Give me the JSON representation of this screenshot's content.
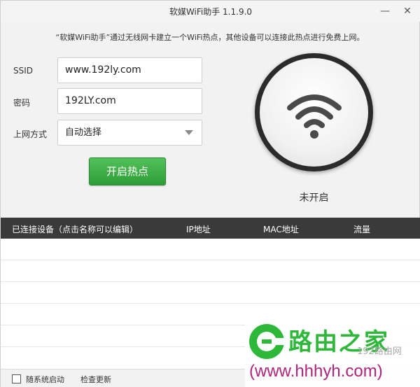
{
  "window": {
    "title": "软媒WiFi助手 1.1.9.0",
    "min_glyph": "—",
    "close_glyph": "✕"
  },
  "description": "“软媒WiFi助手”通过无线网卡建立一个WiFi热点，其他设备可以连接此热点进行免费上网。",
  "form": {
    "ssid_label": "SSID",
    "ssid_value": "www.192ly.com",
    "password_label": "密码",
    "password_value": "192LY.com",
    "mode_label": "上网方式",
    "mode_value": "自动选择"
  },
  "start_button": "开启热点",
  "status": {
    "text": "未开启",
    "icon": "wifi-icon"
  },
  "table": {
    "columns": [
      "已连接设备（点击名称可以编辑）",
      "IP地址",
      "MAC地址",
      "流量"
    ],
    "rows": []
  },
  "footer": {
    "autostart_label": "随系统启动",
    "update_link": "检查更新"
  },
  "watermark": {
    "brand": "路由之家",
    "sub": "192路由网",
    "url": "(www.hhhyh.com)"
  },
  "colors": {
    "accent_green": "#3aac42",
    "header_dark": "#3a3a3a",
    "watermark_url": "#b0257a"
  }
}
